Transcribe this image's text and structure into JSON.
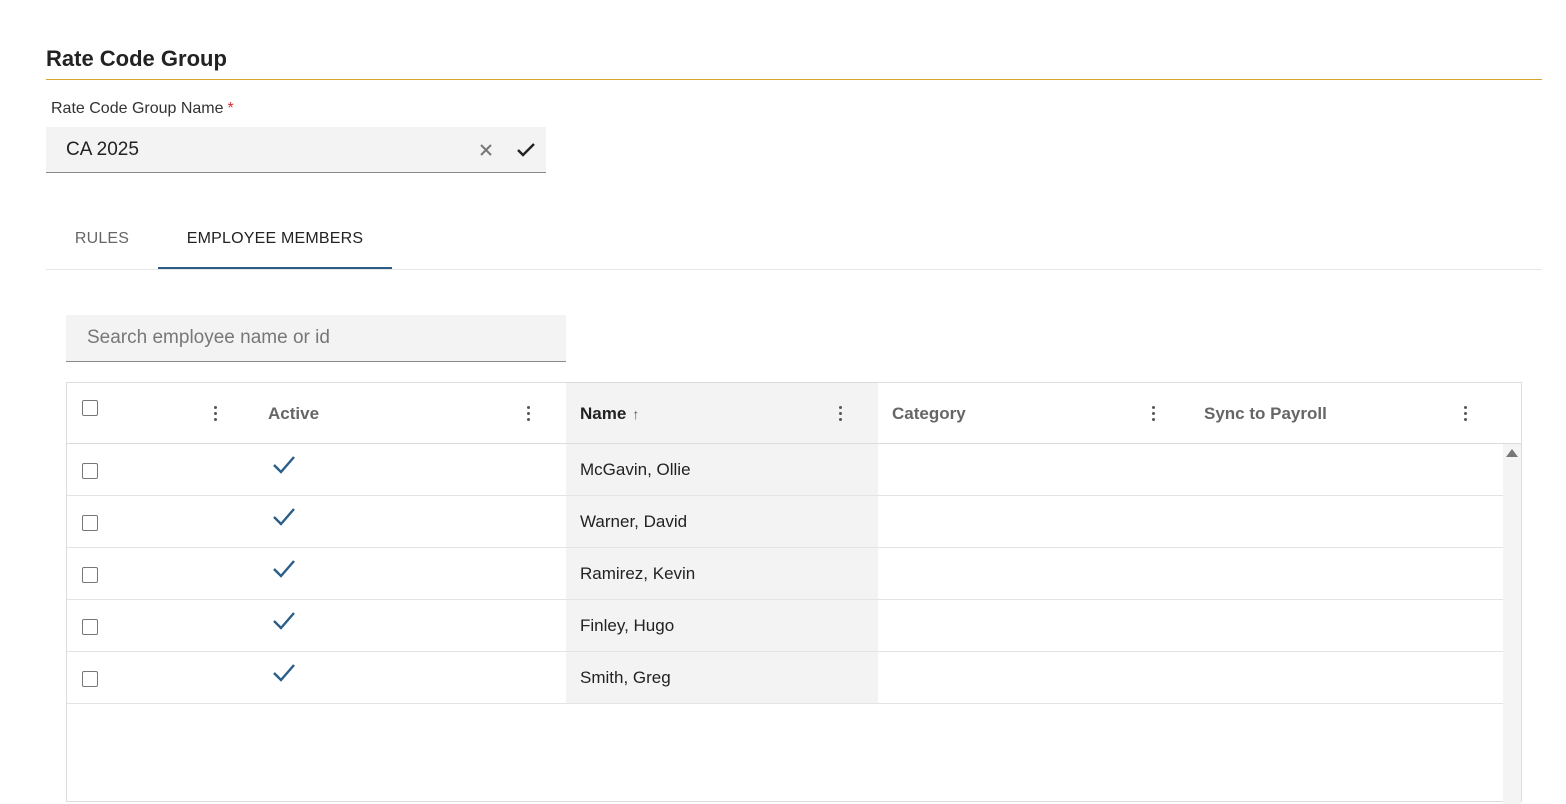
{
  "section": {
    "title": "Rate Code Group"
  },
  "name_field": {
    "label": "Rate Code Group Name",
    "required_marker": "*",
    "value": "CA 2025"
  },
  "tabs": [
    {
      "label": "RULES",
      "active": false
    },
    {
      "label": "EMPLOYEE MEMBERS",
      "active": true
    }
  ],
  "search": {
    "placeholder": "Search employee name or id",
    "value": ""
  },
  "grid": {
    "columns": [
      {
        "label": ""
      },
      {
        "label": "Active"
      },
      {
        "label": "Name",
        "sort": "ascending",
        "sort_glyph": "↑"
      },
      {
        "label": "Category"
      },
      {
        "label": "Sync to Payroll"
      }
    ],
    "rows": [
      {
        "active": true,
        "name": "McGavin, Ollie",
        "category": "",
        "sync": ""
      },
      {
        "active": true,
        "name": "Warner, David",
        "category": "",
        "sync": ""
      },
      {
        "active": true,
        "name": "Ramirez, Kevin",
        "category": "",
        "sync": ""
      },
      {
        "active": true,
        "name": "Finley, Hugo",
        "category": "",
        "sync": ""
      },
      {
        "active": true,
        "name": "Smith, Greg",
        "category": "",
        "sync": ""
      }
    ]
  },
  "colors": {
    "accent": "#2a5d87",
    "section_rule": "#d4a72c",
    "required": "#d32f2f",
    "sorted_column_bg": "#f3f3f3"
  },
  "icons": {
    "clear": "close-icon",
    "confirm": "checkmark-icon",
    "active": "checkmark-icon",
    "column_menu": "kebab-icon",
    "sort": "arrow-up-icon"
  }
}
